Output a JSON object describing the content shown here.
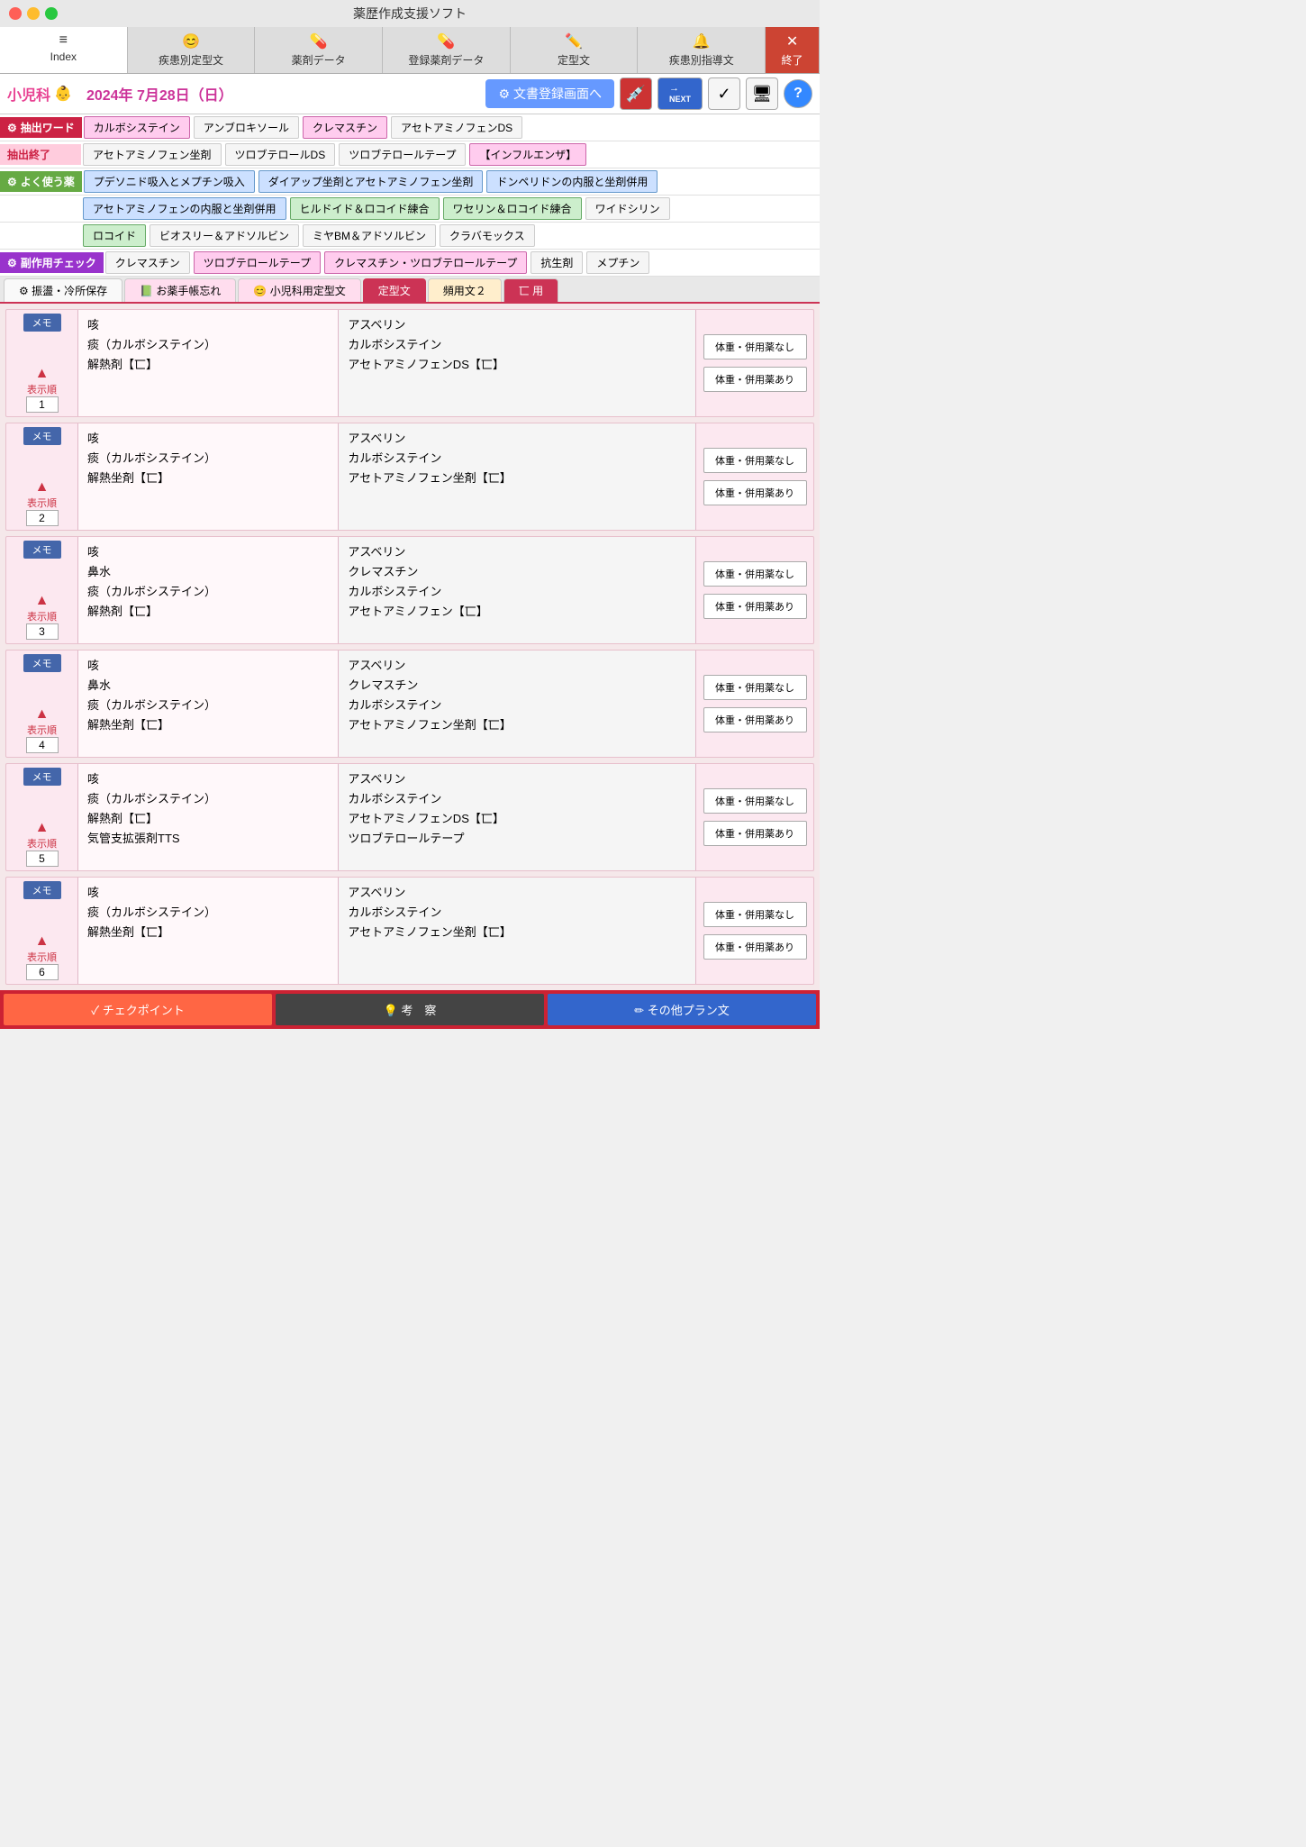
{
  "app": {
    "title": "薬歴作成支援ソフト"
  },
  "nav": {
    "tabs": [
      {
        "id": "index",
        "icon": "≡",
        "label": "Index",
        "active": true
      },
      {
        "id": "disease-fixed",
        "icon": "😊",
        "label": "疾患別定型文"
      },
      {
        "id": "drug-data",
        "icon": "💊",
        "label": "薬剤データ"
      },
      {
        "id": "reg-drug",
        "icon": "💊",
        "label": "登録薬剤データ"
      },
      {
        "id": "fixed-text",
        "icon": "✏️",
        "label": "定型文"
      },
      {
        "id": "disease-guide",
        "icon": "🔔",
        "label": "疾患別指導文"
      },
      {
        "id": "end",
        "icon": "✕",
        "label": "終了"
      }
    ]
  },
  "header": {
    "dept": "小児科",
    "dept_icon": "👶",
    "date": "2024年  7月28日（日）",
    "doc_reg_btn": "文書登録画面へ",
    "gear_icon": "⚙",
    "next_btn": "NEXT",
    "check_icon": "✓",
    "monitor_icon": "🖥",
    "help_icon": "?"
  },
  "tools": {
    "extract_label": "抽出ワード",
    "extract_words": [
      "カルボシステイン",
      "アンブロキソール",
      "クレマスチン",
      "アセトアミノフェンDS"
    ],
    "extract_end": "抽出終了",
    "extract_end_words": [
      "アセトアミノフェン坐剤",
      "ツロブテロールDS",
      "ツロブテロールテープ",
      "【インフルエンザ】"
    ],
    "common_label": "よく使う薬",
    "common_words": [
      "プデソニド吸入とメプチン吸入",
      "ダイアップ坐剤とアセトアミノフェン坐剤",
      "ドンペリドンの内服と坐剤併用"
    ],
    "common_words2": [
      "アセトアミノフェンの内服と坐剤併用",
      "ヒルドイド＆ロコイド練合",
      "ワセリン＆ロコイド練合",
      "ワイドシリン"
    ],
    "common_words3": [
      "ロコイド",
      "ビオスリー＆アドソルビン",
      "ミヤBM＆アドソルビン",
      "クラバモックス"
    ],
    "side_effect_label": "副作用チェック",
    "side_effect_words": [
      "クレマスチン",
      "ツロブテロールテープ",
      "クレマスチン・ツロブテロールテープ",
      "抗生剤",
      "メプチン"
    ]
  },
  "page_tabs": [
    {
      "label": "振盪・冷所保存",
      "icon": "⚙",
      "type": "gear"
    },
    {
      "label": "お薬手帳忘れ",
      "icon": "📗",
      "type": "book"
    },
    {
      "label": "小児科用定型文",
      "icon": "😊",
      "type": "smiley"
    },
    {
      "label": "定型文",
      "active": true
    },
    {
      "label": "頻用文２"
    },
    {
      "label": "匸 用"
    }
  ],
  "cards": [
    {
      "id": 1,
      "order": "1",
      "symptoms": "咳\n痰（カルボシステイン）\n解熱剤【匸】",
      "prescription": "アスベリン\nカルボシステイン\nアセトアミノフェンDS【匸】",
      "btn_no_concomitant": "体重・併用薬なし",
      "btn_with_concomitant": "体重・併用薬あり"
    },
    {
      "id": 2,
      "order": "2",
      "symptoms": "咳\n痰（カルボシステイン）\n解熱坐剤【匸】",
      "prescription": "アスベリン\nカルボシステイン\nアセトアミノフェン坐剤【匸】",
      "btn_no_concomitant": "体重・併用薬なし",
      "btn_with_concomitant": "体重・併用薬あり"
    },
    {
      "id": 3,
      "order": "3",
      "symptoms": "咳\n鼻水\n痰（カルボシステイン）\n解熱剤【匸】",
      "prescription": "アスベリン\nクレマスチン\nカルボシステイン\nアセトアミノフェン【匸】",
      "btn_no_concomitant": "体重・併用薬なし",
      "btn_with_concomitant": "体重・併用薬あり"
    },
    {
      "id": 4,
      "order": "4",
      "symptoms": "咳\n鼻水\n痰（カルボシステイン）\n解熱坐剤【匸】",
      "prescription": "アスベリン\nクレマスチン\nカルボシステイン\nアセトアミノフェン坐剤【匸】",
      "btn_no_concomitant": "体重・併用薬なし",
      "btn_with_concomitant": "体重・併用薬あり"
    },
    {
      "id": 5,
      "order": "5",
      "symptoms": "咳\n痰（カルボシステイン）\n解熱剤【匸】\n気管支拡張剤TTS",
      "prescription": "アスベリン\nカルボシステイン\nアセトアミノフェンDS【匸】\nツロブテロールテープ",
      "btn_no_concomitant": "体重・併用薬なし",
      "btn_with_concomitant": "体重・併用薬あり"
    },
    {
      "id": 6,
      "order": "6",
      "symptoms": "咳\n痰（カルボシステイン）\n解熱坐剤【匸】",
      "prescription": "アスベリン\nカルボシステイン\nアセトアミノフェン坐剤【匸】",
      "btn_no_concomitant": "体重・併用薬なし",
      "btn_with_concomitant": "体重・併用薬あり"
    }
  ],
  "bottom_bar": {
    "checkpoint": "✓ チェクポイント",
    "consideration": "💡 考　察",
    "other_plan": "✏ その他プラン文"
  }
}
